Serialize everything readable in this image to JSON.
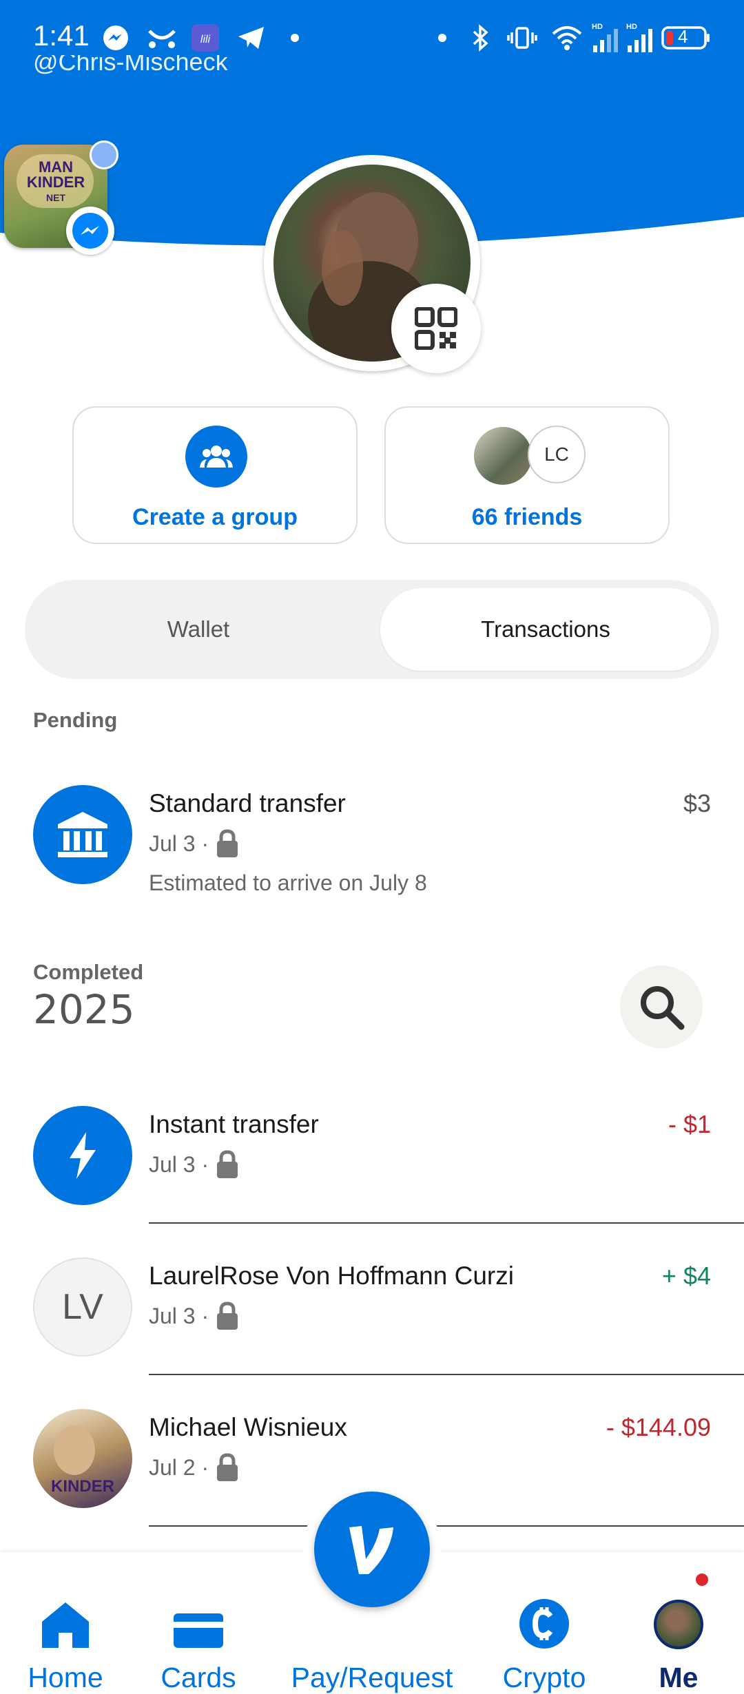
{
  "status_bar": {
    "time": "1:41",
    "battery": "4",
    "signal_labels": [
      "HD",
      "HD"
    ]
  },
  "header": {
    "handle": "@Chris-Mischeck",
    "background_color": "#0074de"
  },
  "actions": {
    "create_group_label": "Create a group",
    "friends_label": "66 friends",
    "friend_initials": "LC"
  },
  "tabs": {
    "wallet": "Wallet",
    "transactions": "Transactions",
    "selected": "Transactions"
  },
  "pending": {
    "section_label": "Pending",
    "items": [
      {
        "title": "Standard transfer",
        "date": "Jul 3 ·",
        "note": "Estimated to arrive on July 8",
        "amount": "$3",
        "icon": "bank-icon"
      }
    ]
  },
  "completed": {
    "section_label": "Completed",
    "year": "2025",
    "items": [
      {
        "title": "Instant transfer",
        "date": "Jul 3 ·",
        "amount": "- $1",
        "icon": "lightning-icon"
      },
      {
        "title": "LaurelRose Von Hoffmann Curzi",
        "date": "Jul 3 ·",
        "amount": "+ $4",
        "initials": "LV"
      },
      {
        "title": "Michael Wisnieux",
        "date": "Jul 2 ·",
        "amount": "- $144.09",
        "icon": "avatar"
      }
    ]
  },
  "chathead": {
    "line1": "MAN",
    "line2": "KINDER",
    "line3": "NET"
  },
  "bottom_nav": {
    "home": "Home",
    "cards": "Cards",
    "pay_request": "Pay/Request",
    "crypto": "Crypto",
    "me": "Me",
    "fab_letter": "V"
  },
  "colors": {
    "brand_blue": "#0074de",
    "negative": "#c0262d",
    "positive": "#12855a"
  }
}
